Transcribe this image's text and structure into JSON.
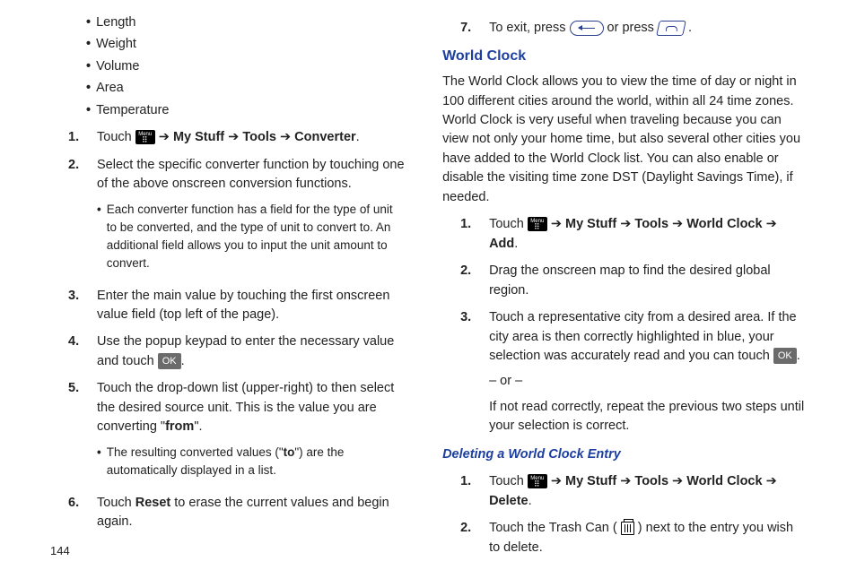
{
  "page_number": "144",
  "left": {
    "bullets": [
      "Length",
      "Weight",
      "Volume",
      "Area",
      "Temperature"
    ],
    "steps": [
      {
        "num": "1.",
        "prefix": "Touch ",
        "path_parts": [
          "My Stuff",
          "Tools",
          "Converter"
        ],
        "has_menu_icon": true
      },
      {
        "num": "2.",
        "text": "Select the specific converter function by touching one of the above onscreen conversion functions.",
        "sub": "Each converter function has a field for the type of unit to be converted, and the type of unit to convert to. An additional field allows you to input the unit amount to convert."
      },
      {
        "num": "3.",
        "text": "Enter the main value by touching the first onscreen value field (top left of the page)."
      },
      {
        "num": "4.",
        "text_before": "Use the popup keypad to enter the necessary value and touch ",
        "ok": "OK",
        "text_after": "."
      },
      {
        "num": "5.",
        "text_before": "Touch the drop-down list (upper-right) to then select the desired source unit. This is the value you are converting \"",
        "bold_word": "from",
        "text_after": "\".",
        "sub_before": "The resulting converted values (\"",
        "sub_bold": "to",
        "sub_after": "\") are the automatically displayed in a list."
      },
      {
        "num": "6.",
        "text_before": "Touch ",
        "bold_word": "Reset",
        "text_after": " to erase the current values and begin again."
      }
    ]
  },
  "right": {
    "exit_step": {
      "num": "7.",
      "before": "To exit, press ",
      "mid": " or press ",
      "after": "."
    },
    "world_clock_title": "World Clock",
    "world_clock_intro": "The World Clock allows you to view the time of day or night in 100 different cities around the world, within all 24 time zones. World Clock is very useful when traveling because you can view not only your home time, but also several other cities you have added to the World Clock list. You can also enable or disable the visiting time zone DST (Daylight Savings Time), if needed.",
    "wc_steps": {
      "s1": {
        "num": "1.",
        "prefix": "Touch ",
        "path_parts": [
          "My Stuff",
          "Tools",
          "World Clock",
          "Add"
        ]
      },
      "s2": {
        "num": "2.",
        "text": "Drag the onscreen map to find the desired global region."
      },
      "s3": {
        "num": "3.",
        "before": "Touch a representative city from a desired area. If the city area is then correctly highlighted in blue, your selection was accurately read and you can touch ",
        "ok": "OK",
        "after": ".",
        "or": "– or –",
        "fallback": "If not read correctly, repeat the previous two steps until your selection is correct."
      }
    },
    "delete_title": "Deleting a World Clock Entry",
    "del_steps": {
      "s1": {
        "num": "1.",
        "prefix": "Touch ",
        "path_parts": [
          "My Stuff",
          "Tools",
          "World Clock",
          "Delete"
        ]
      },
      "s2": {
        "num": "2.",
        "before": "Touch the Trash Can (",
        "after": ") next to the entry you wish to delete."
      }
    }
  },
  "icons": {
    "menu_label": "Menu"
  },
  "arrow": "➔"
}
